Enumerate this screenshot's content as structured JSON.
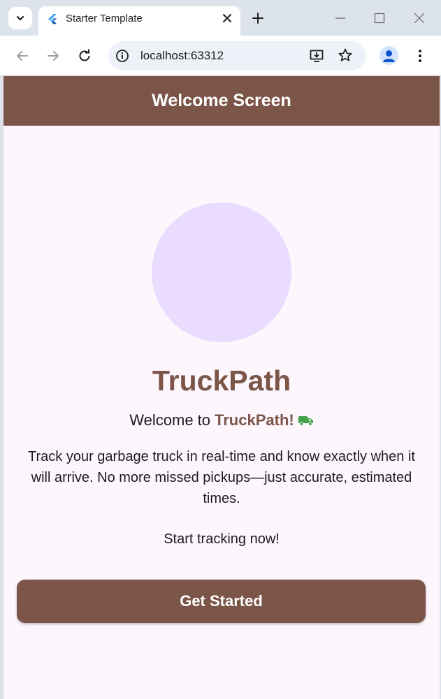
{
  "browser": {
    "tab_title": "Starter Template",
    "url": "localhost:63312"
  },
  "colors": {
    "brand": "#7b5548",
    "avatar_bg": "#eadcff",
    "page_bg": "#fdf6fd",
    "truck": "#43a047"
  },
  "appbar": {
    "title": "Welcome Screen"
  },
  "hero": {
    "app_name": "TruckPath",
    "welcome_prefix": "Welcome to",
    "welcome_brand": "TruckPath!",
    "welcome_icon": "truck-icon",
    "description": "Track your garbage truck in real-time and know exactly when it will arrive. No more missed pickups—just accurate, estimated times.",
    "cta_text": "Start tracking now!"
  },
  "button": {
    "label": "Get Started"
  }
}
